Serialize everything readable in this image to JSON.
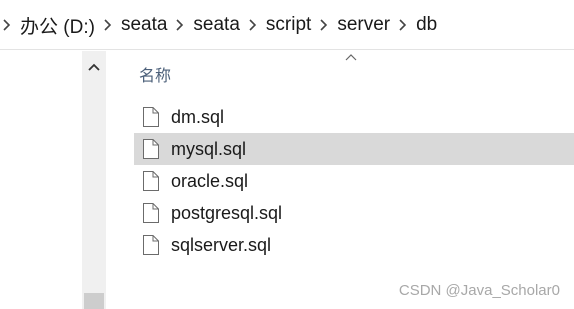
{
  "breadcrumb": {
    "items": [
      "办公 (D:)",
      "seata",
      "seata",
      "script",
      "server",
      "db"
    ]
  },
  "column_header": {
    "name_label": "名称"
  },
  "files": [
    {
      "name": "dm.sql",
      "selected": false
    },
    {
      "name": "mysql.sql",
      "selected": true
    },
    {
      "name": "oracle.sql",
      "selected": false
    },
    {
      "name": "postgresql.sql",
      "selected": false
    },
    {
      "name": "sqlserver.sql",
      "selected": false
    }
  ],
  "watermark": "CSDN @Java_Scholar0",
  "icons": {
    "separator": "chevron-right-icon",
    "scroll_up": "chevron-up-icon",
    "sort": "sort-ascending-icon",
    "file": "file-icon"
  },
  "colors": {
    "selected_row": "#d9d9d9",
    "header_text": "#4c607a",
    "scrollbar_track": "#f0f0f0",
    "scrollbar_thumb": "#cdcdcd"
  }
}
